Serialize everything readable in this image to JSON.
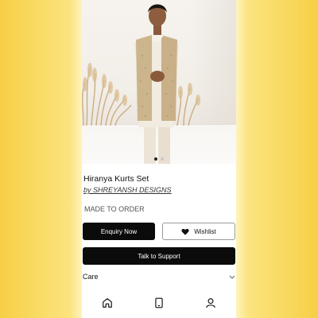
{
  "product": {
    "title": "Hiranya Kurts Set",
    "designer_link": "by SHREYANSH DESIGNS",
    "availability": "MADE TO ORDER"
  },
  "carousel": {
    "slides": 2,
    "active_index": 0
  },
  "actions": {
    "enquiry_label": "Enquiry Now",
    "wishlist_label": "Wishlist",
    "support_label": "Talk to Support"
  },
  "accordion": {
    "care_label": "Care"
  },
  "bottom_nav": {
    "icons": [
      "home-icon",
      "phone-icon",
      "profile-icon"
    ]
  },
  "colors": {
    "background_gradient_edge": "#f7cf45",
    "button_primary": "#0b0b0b",
    "button_text_primary": "#ffffff"
  }
}
